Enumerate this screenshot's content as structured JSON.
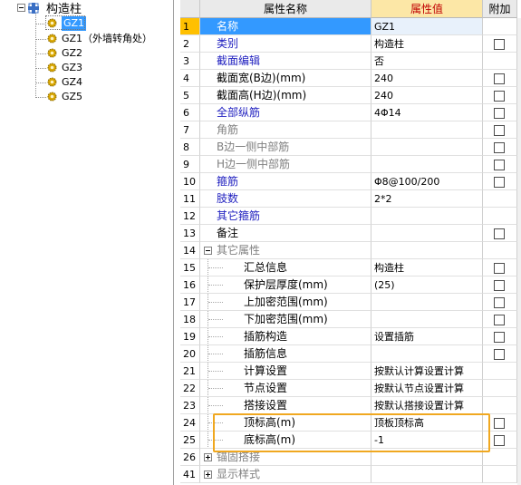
{
  "tree": {
    "root_label": "构造柱",
    "items": [
      {
        "label": "GZ1",
        "selected": true
      },
      {
        "label": "GZ1（外墙转角处）",
        "selected": false
      },
      {
        "label": "GZ2",
        "selected": false
      },
      {
        "label": "GZ3",
        "selected": false
      },
      {
        "label": "GZ4",
        "selected": false
      },
      {
        "label": "GZ5",
        "selected": false
      }
    ]
  },
  "grid": {
    "headers": {
      "name": "属性名称",
      "value": "属性值",
      "add": "附加"
    },
    "rows": [
      {
        "num": "1",
        "name": "名称",
        "value": "GZ1",
        "style": "sel",
        "checkbox": false
      },
      {
        "num": "2",
        "name": "类别",
        "value": "构造柱",
        "style": "blue",
        "checkbox": true
      },
      {
        "num": "3",
        "name": "截面编辑",
        "value": "否",
        "style": "blue",
        "checkbox": false
      },
      {
        "num": "4",
        "name": "截面宽(B边)(mm)",
        "value": "240",
        "style": "normal",
        "checkbox": true
      },
      {
        "num": "5",
        "name": "截面高(H边)(mm)",
        "value": "240",
        "style": "normal",
        "checkbox": true
      },
      {
        "num": "6",
        "name": "全部纵筋",
        "value": "4Φ14",
        "style": "blue",
        "checkbox": true
      },
      {
        "num": "7",
        "name": "角筋",
        "value": "",
        "style": "gray",
        "checkbox": true
      },
      {
        "num": "8",
        "name": "B边一侧中部筋",
        "value": "",
        "style": "gray",
        "checkbox": true
      },
      {
        "num": "9",
        "name": "H边一侧中部筋",
        "value": "",
        "style": "gray",
        "checkbox": true
      },
      {
        "num": "10",
        "name": "箍筋",
        "value": "Φ8@100/200",
        "style": "blue",
        "checkbox": true
      },
      {
        "num": "11",
        "name": "肢数",
        "value": "2*2",
        "style": "blue",
        "checkbox": false
      },
      {
        "num": "12",
        "name": "其它箍筋",
        "value": "",
        "style": "blue",
        "checkbox": false
      },
      {
        "num": "13",
        "name": "备注",
        "value": "",
        "style": "normal",
        "checkbox": true
      },
      {
        "num": "14",
        "name": "其它属性",
        "value": "",
        "style": "group",
        "checkbox": false
      },
      {
        "num": "15",
        "name": "汇总信息",
        "value": "构造柱",
        "style": "sub",
        "checkbox": true
      },
      {
        "num": "16",
        "name": "保护层厚度(mm)",
        "value": "(25)",
        "style": "sub",
        "checkbox": true
      },
      {
        "num": "17",
        "name": "上加密范围(mm)",
        "value": "",
        "style": "sub",
        "checkbox": true
      },
      {
        "num": "18",
        "name": "下加密范围(mm)",
        "value": "",
        "style": "sub",
        "checkbox": true
      },
      {
        "num": "19",
        "name": "插筋构造",
        "value": "设置插筋",
        "style": "sub",
        "checkbox": true
      },
      {
        "num": "20",
        "name": "插筋信息",
        "value": "",
        "style": "sub",
        "checkbox": true
      },
      {
        "num": "21",
        "name": "计算设置",
        "value": "按默认计算设置计算",
        "style": "sub",
        "checkbox": false
      },
      {
        "num": "22",
        "name": "节点设置",
        "value": "按默认节点设置计算",
        "style": "sub",
        "checkbox": false
      },
      {
        "num": "23",
        "name": "搭接设置",
        "value": "按默认搭接设置计算",
        "style": "sub",
        "checkbox": false
      },
      {
        "num": "24",
        "name": "顶标高(m)",
        "value": "顶板顶标高",
        "style": "sub",
        "checkbox": true
      },
      {
        "num": "25",
        "name": "底标高(m)",
        "value": "-1",
        "style": "sub",
        "checkbox": true
      },
      {
        "num": "26",
        "name": "锚固搭接",
        "value": "",
        "style": "collapsed",
        "checkbox": false
      },
      {
        "num": "41",
        "name": "显示样式",
        "value": "",
        "style": "collapsed",
        "checkbox": false
      }
    ]
  },
  "colors": {
    "selection_blue": "#3399ff",
    "row_num_selected": "#ffc000",
    "highlight_box": "#f0a820",
    "value_header": "#fce7a6"
  }
}
